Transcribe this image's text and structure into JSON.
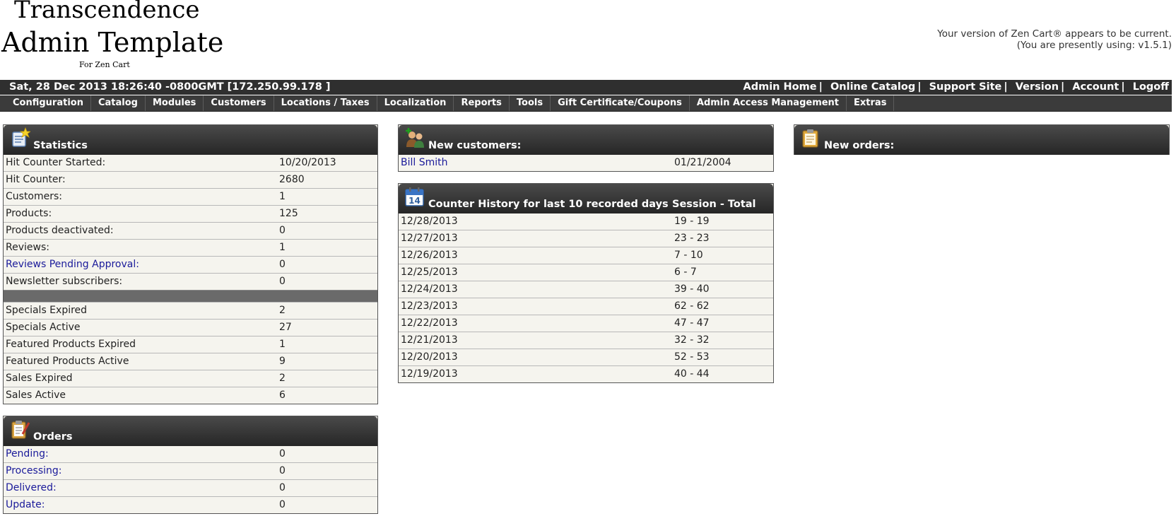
{
  "logo": {
    "line1": "Transcendence",
    "line2": "Admin Template",
    "line3": "For Zen Cart"
  },
  "version_info": {
    "line1": "Your version of Zen Cart® appears to be current.",
    "line2": "(You are presently using: v1.5.1)"
  },
  "topbar": {
    "datetime": "Sat, 28 Dec 2013 18:26:40 -0800GMT [172.250.99.178 ]",
    "links": [
      "Admin Home",
      "Online Catalog",
      "Support Site",
      "Version",
      "Account",
      "Logoff"
    ],
    "separator": "|"
  },
  "menu": [
    "Configuration",
    "Catalog",
    "Modules",
    "Customers",
    "Locations / Taxes",
    "Localization",
    "Reports",
    "Tools",
    "Gift Certificate/Coupons",
    "Admin Access Management",
    "Extras"
  ],
  "statistics": {
    "title": "Statistics",
    "rows": [
      {
        "k": "Hit Counter Started:",
        "v": "10/20/2013"
      },
      {
        "k": "Hit Counter:",
        "v": "2680"
      },
      {
        "k": "Customers:",
        "v": "1"
      },
      {
        "k": "Products:",
        "v": "125"
      },
      {
        "k": "Products deactivated:",
        "v": "0"
      },
      {
        "k": "Reviews:",
        "v": "1"
      },
      {
        "k": "Reviews Pending Approval:",
        "v": "0"
      },
      {
        "k": "Newsletter subscribers:",
        "v": "0"
      }
    ],
    "rows2": [
      {
        "k": "Specials Expired",
        "v": "2"
      },
      {
        "k": "Specials Active",
        "v": "27"
      },
      {
        "k": "Featured Products Expired",
        "v": "1"
      },
      {
        "k": "Featured Products Active",
        "v": "9"
      },
      {
        "k": "Sales Expired",
        "v": "2"
      },
      {
        "k": "Sales Active",
        "v": "6"
      }
    ]
  },
  "orders": {
    "title": "Orders",
    "rows": [
      {
        "k": "Pending:",
        "v": "0"
      },
      {
        "k": "Processing:",
        "v": "0"
      },
      {
        "k": "Delivered:",
        "v": "0"
      },
      {
        "k": "Update:",
        "v": "0"
      }
    ]
  },
  "new_customers": {
    "title": "New customers:",
    "rows": [
      {
        "k": "Bill Smith",
        "v": "01/21/2004"
      }
    ]
  },
  "counter_history": {
    "title": "Counter History for last 10 recorded days",
    "col2": "Session - Total",
    "rows": [
      {
        "k": "12/28/2013",
        "v": "19 - 19"
      },
      {
        "k": "12/27/2013",
        "v": "23 - 23"
      },
      {
        "k": "12/26/2013",
        "v": "7 - 10"
      },
      {
        "k": "12/25/2013",
        "v": "6 - 7"
      },
      {
        "k": "12/24/2013",
        "v": "39 - 40"
      },
      {
        "k": "12/23/2013",
        "v": "62 - 62"
      },
      {
        "k": "12/22/2013",
        "v": "47 - 47"
      },
      {
        "k": "12/21/2013",
        "v": "32 - 32"
      },
      {
        "k": "12/20/2013",
        "v": "52 - 53"
      },
      {
        "k": "12/19/2013",
        "v": "40 - 44"
      }
    ]
  },
  "new_orders": {
    "title": "New orders:"
  }
}
